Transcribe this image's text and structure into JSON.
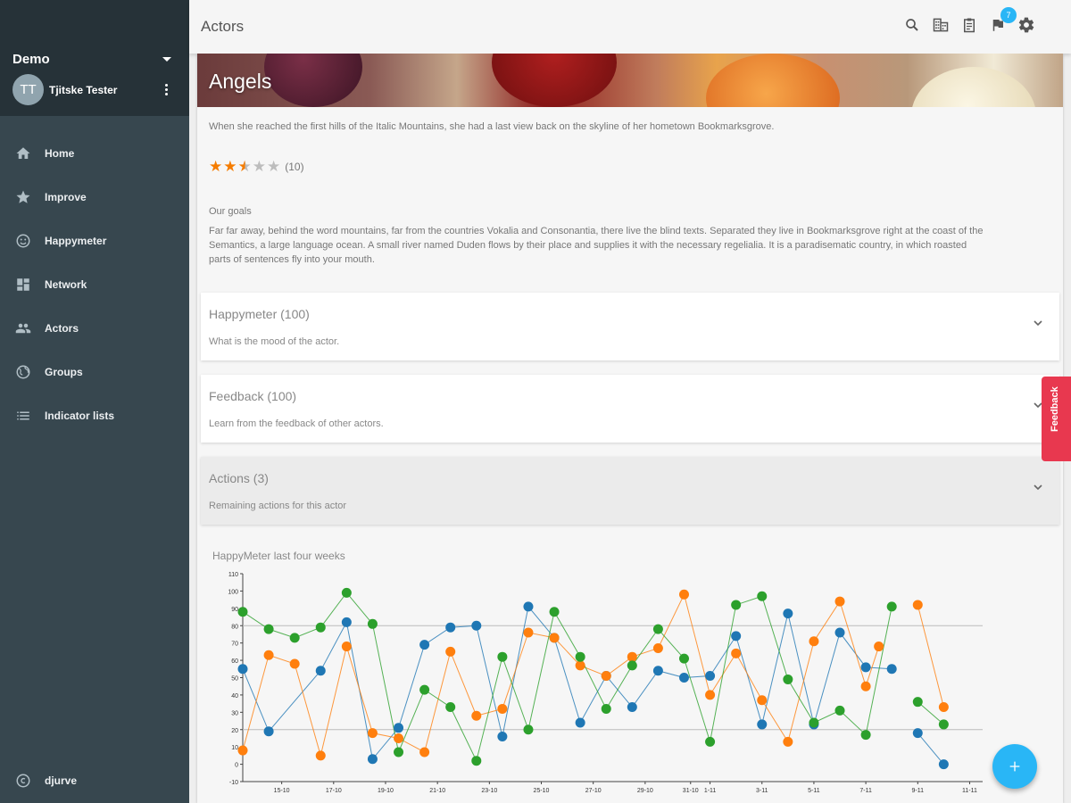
{
  "sidebar": {
    "org_name": "Demo",
    "user": {
      "initials": "TT",
      "name": "Tjitske Tester"
    },
    "items": [
      {
        "label": "Home",
        "icon": "home-icon"
      },
      {
        "label": "Improve",
        "icon": "star-icon"
      },
      {
        "label": "Happymeter",
        "icon": "smiley-icon"
      },
      {
        "label": "Network",
        "icon": "dashboard-icon"
      },
      {
        "label": "Actors",
        "icon": "people-icon"
      },
      {
        "label": "Groups",
        "icon": "globe-icon"
      },
      {
        "label": "Indicator lists",
        "icon": "list-icon"
      }
    ],
    "bottom_item": {
      "label": "djurve",
      "icon": "copyright-icon"
    }
  },
  "topbar": {
    "title": "Actors",
    "icons": [
      "search-icon",
      "building-icon",
      "clipboard-icon",
      "flag-icon",
      "settings-icon"
    ],
    "flag_badge": "7"
  },
  "actor": {
    "name": "Angels",
    "description": "When she reached the first hills of the Italic Mountains, she had a last view back on the skyline of her hometown Bookmarksgrove.",
    "rating": {
      "value": 2.5,
      "max": 5,
      "count_label": "(10)"
    },
    "goals_title": "Our goals",
    "goals_text": "Far far away, behind the word mountains, far from the countries Vokalia and Consonantia, there live the blind texts. Separated they live in Bookmarksgrove right at the coast of the Semantics, a large language ocean. A small river named Duden flows by their place and supplies it with the necessary regelialia. It is a paradisematic country, in which roasted parts of sentences fly into your mouth."
  },
  "panels": [
    {
      "title": "Happymeter (100)",
      "subtitle": "What is the mood of the actor."
    },
    {
      "title": "Feedback (100)",
      "subtitle": "Learn from the feedback of other actors."
    },
    {
      "title": "Actions (3)",
      "subtitle": "Remaining actions for this actor"
    }
  ],
  "feedback_tab": {
    "label": "Feedback"
  },
  "fab": {
    "label": "+"
  },
  "colors": {
    "sidebar": "#37474f",
    "sidebar_header": "#263238",
    "accent": "#29b6f6",
    "feedback": "#e8384f",
    "star": "#f57c00"
  },
  "chart_data": {
    "type": "line",
    "title": "HappyMeter last four weeks",
    "ylim": [
      -10,
      110
    ],
    "yticks": [
      -10,
      0,
      10,
      20,
      30,
      40,
      50,
      60,
      70,
      80,
      90,
      100,
      110
    ],
    "xlim": [
      0,
      57
    ],
    "xticks": [
      {
        "x": 3,
        "label": "15-10"
      },
      {
        "x": 7,
        "label": "17-10"
      },
      {
        "x": 11,
        "label": "19-10"
      },
      {
        "x": 15,
        "label": "21-10"
      },
      {
        "x": 19,
        "label": "23-10"
      },
      {
        "x": 23,
        "label": "25-10"
      },
      {
        "x": 27,
        "label": "27-10"
      },
      {
        "x": 31,
        "label": "29-10"
      },
      {
        "x": 34.5,
        "label": "31-10"
      },
      {
        "x": 36,
        "label": "1-11"
      },
      {
        "x": 40,
        "label": "3-11"
      },
      {
        "x": 44,
        "label": "5-11"
      },
      {
        "x": 48,
        "label": "7-11"
      },
      {
        "x": 52,
        "label": "9-11"
      },
      {
        "x": 56,
        "label": "11-11"
      }
    ],
    "thresholds": [
      80,
      20
    ],
    "series": [
      {
        "color": "#1f77b4",
        "values": [
          [
            0,
            55
          ],
          [
            2,
            19
          ],
          [
            6,
            54
          ],
          [
            8,
            82
          ],
          [
            10,
            3
          ],
          [
            12,
            21
          ],
          [
            14,
            69
          ],
          [
            16,
            79
          ],
          [
            18,
            80
          ],
          [
            20,
            16
          ],
          [
            22,
            91
          ],
          [
            24,
            73
          ],
          [
            26,
            24
          ],
          [
            28,
            51
          ],
          [
            30,
            33
          ],
          [
            32,
            54
          ],
          [
            34,
            50
          ],
          [
            36,
            51
          ],
          [
            38,
            74
          ],
          [
            40,
            23
          ],
          [
            42,
            87
          ],
          [
            44,
            23
          ],
          [
            46,
            76
          ],
          [
            48,
            56
          ],
          [
            50,
            55
          ],
          [
            null,
            null
          ],
          [
            52,
            18
          ],
          [
            54,
            0
          ]
        ]
      },
      {
        "color": "#ff7f0e",
        "values": [
          [
            0,
            8
          ],
          [
            2,
            63
          ],
          [
            4,
            58
          ],
          [
            6,
            5
          ],
          [
            8,
            68
          ],
          [
            10,
            18
          ],
          [
            12,
            15
          ],
          [
            14,
            7
          ],
          [
            16,
            65
          ],
          [
            18,
            28
          ],
          [
            20,
            32
          ],
          [
            22,
            76
          ],
          [
            24,
            73
          ],
          [
            26,
            57
          ],
          [
            28,
            51
          ],
          [
            30,
            62
          ],
          [
            32,
            67
          ],
          [
            34,
            98
          ],
          [
            36,
            40
          ],
          [
            38,
            64
          ],
          [
            40,
            37
          ],
          [
            42,
            13
          ],
          [
            44,
            71
          ],
          [
            46,
            94
          ],
          [
            48,
            45
          ],
          [
            49,
            68
          ],
          [
            null,
            null
          ],
          [
            52,
            92
          ],
          [
            54,
            33
          ]
        ]
      },
      {
        "color": "#2ca02c",
        "values": [
          [
            0,
            88
          ],
          [
            2,
            78
          ],
          [
            4,
            73
          ],
          [
            6,
            79
          ],
          [
            8,
            99
          ],
          [
            10,
            81
          ],
          [
            12,
            7
          ],
          [
            14,
            43
          ],
          [
            16,
            33
          ],
          [
            18,
            2
          ],
          [
            20,
            62
          ],
          [
            22,
            20
          ],
          [
            24,
            88
          ],
          [
            26,
            62
          ],
          [
            28,
            32
          ],
          [
            30,
            57
          ],
          [
            32,
            78
          ],
          [
            34,
            61
          ],
          [
            36,
            13
          ],
          [
            38,
            92
          ],
          [
            40,
            97
          ],
          [
            42,
            49
          ],
          [
            44,
            24
          ],
          [
            46,
            31
          ],
          [
            48,
            17
          ],
          [
            50,
            91
          ],
          [
            null,
            null
          ],
          [
            52,
            36
          ],
          [
            54,
            23
          ]
        ]
      }
    ]
  }
}
